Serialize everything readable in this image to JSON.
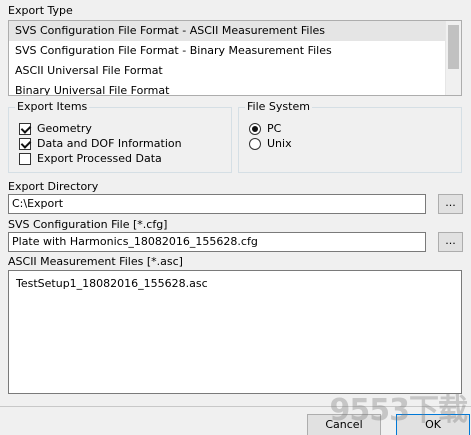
{
  "export_type": {
    "title": "Export Type",
    "items": [
      "SVS Configuration File Format - ASCII Measurement Files",
      "SVS Configuration File Format - Binary Measurement Files",
      "ASCII Universal File Format",
      "Binary Universal File Format"
    ],
    "selected_index": 0
  },
  "export_items": {
    "title": "Export Items",
    "options": [
      {
        "label": "Geometry",
        "checked": true
      },
      {
        "label": "Data and DOF Information",
        "checked": true
      },
      {
        "label": "Export Processed Data",
        "checked": false
      }
    ]
  },
  "file_system": {
    "title": "File System",
    "options": [
      {
        "label": "PC",
        "selected": true
      },
      {
        "label": "Unix",
        "selected": false
      }
    ]
  },
  "export_directory": {
    "label": "Export Directory",
    "value": "C:\\Export",
    "browse_label": "..."
  },
  "svs_config_file": {
    "label": "SVS Configuration File [*.cfg]",
    "value": "Plate with Harmonics_18082016_155628.cfg",
    "browse_label": "..."
  },
  "ascii_files": {
    "label": "ASCII Measurement Files [*.asc]",
    "value": "TestSetup1_18082016_155628.asc"
  },
  "buttons": {
    "cancel": "Cancel",
    "ok": "OK"
  },
  "watermark": "9553下载"
}
